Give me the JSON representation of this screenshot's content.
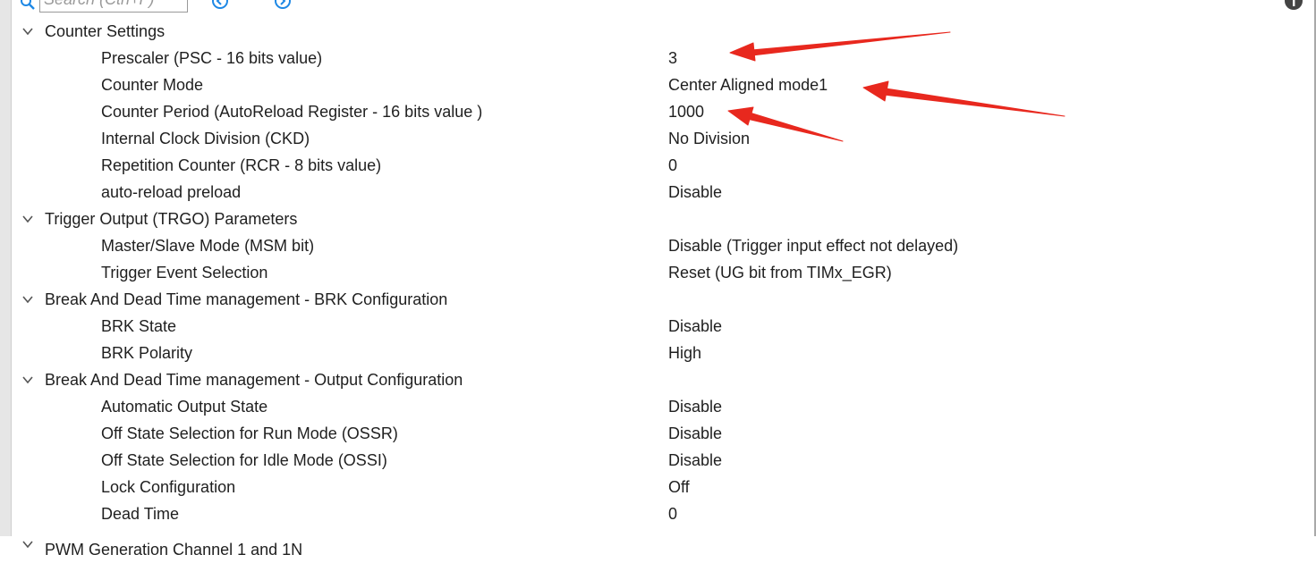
{
  "toolbar": {
    "search_placeholder": "Search (Ctrl+F)"
  },
  "tree": {
    "groups": [
      {
        "title": "Counter Settings",
        "params": [
          {
            "label": "Prescaler (PSC - 16 bits value)",
            "value": "3"
          },
          {
            "label": "Counter Mode",
            "value": "Center Aligned mode1"
          },
          {
            "label": "Counter Period (AutoReload Register - 16 bits value )",
            "value": "1000"
          },
          {
            "label": "Internal Clock Division (CKD)",
            "value": "No Division"
          },
          {
            "label": "Repetition Counter (RCR - 8 bits value)",
            "value": "0"
          },
          {
            "label": "auto-reload preload",
            "value": "Disable"
          }
        ]
      },
      {
        "title": "Trigger Output (TRGO) Parameters",
        "params": [
          {
            "label": "Master/Slave Mode (MSM bit)",
            "value": "Disable (Trigger input effect not delayed)"
          },
          {
            "label": "Trigger Event Selection",
            "value": "Reset (UG bit from TIMx_EGR)"
          }
        ]
      },
      {
        "title": "Break And Dead Time management - BRK Configuration",
        "params": [
          {
            "label": "BRK State",
            "value": "Disable"
          },
          {
            "label": "BRK Polarity",
            "value": "High"
          }
        ]
      },
      {
        "title": "Break And Dead Time management - Output Configuration",
        "params": [
          {
            "label": "Automatic Output State",
            "value": "Disable"
          },
          {
            "label": "Off State Selection for Run Mode (OSSR)",
            "value": "Disable"
          },
          {
            "label": "Off State Selection for Idle Mode (OSSI)",
            "value": "Disable"
          },
          {
            "label": "Lock Configuration",
            "value": "Off"
          },
          {
            "label": "Dead Time",
            "value": "0"
          }
        ]
      },
      {
        "title": "PWM Generation Channel 1 and 1N",
        "params": []
      }
    ]
  },
  "colors": {
    "text": "#1f1f1f",
    "annotation_arrow": "#e8281e",
    "toolbar_icon": "#1e88e5",
    "chevron": "#555555"
  },
  "icons": [
    "search-icon",
    "collapse-all-icon",
    "expand-all-icon",
    "info-icon",
    "chevron-down-icon"
  ]
}
